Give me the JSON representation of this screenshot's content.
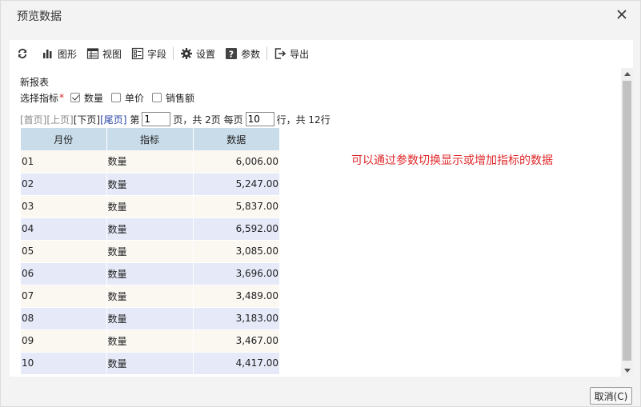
{
  "window": {
    "title": "预览数据"
  },
  "toolbar": {
    "chart": "图形",
    "view": "视图",
    "fields": "字段",
    "settings": "设置",
    "params": "参数",
    "export": "导出"
  },
  "report": {
    "title": "新报表"
  },
  "indicator": {
    "label": "选择指标",
    "required_mark": "*",
    "options": [
      {
        "label": "数量",
        "checked": true
      },
      {
        "label": "单价",
        "checked": false
      },
      {
        "label": "销售额",
        "checked": false
      }
    ]
  },
  "pager": {
    "first": "[首页]",
    "prev": "[上页]",
    "next": "[下页]",
    "last": "[尾页]",
    "page_prefix": "第",
    "page_value": "1",
    "page_suffix": "页，共 2页 每页",
    "size_value": "10",
    "size_suffix": "行，共 12行"
  },
  "table": {
    "headers": [
      "月份",
      "指标",
      "数据"
    ],
    "rows": [
      [
        "01",
        "数量",
        "6,006.00"
      ],
      [
        "02",
        "数量",
        "5,247.00"
      ],
      [
        "03",
        "数量",
        "5,837.00"
      ],
      [
        "04",
        "数量",
        "6,592.00"
      ],
      [
        "05",
        "数量",
        "3,085.00"
      ],
      [
        "06",
        "数量",
        "3,696.00"
      ],
      [
        "07",
        "数量",
        "3,489.00"
      ],
      [
        "08",
        "数量",
        "3,183.00"
      ],
      [
        "09",
        "数量",
        "3,467.00"
      ],
      [
        "10",
        "数量",
        "4,417.00"
      ]
    ]
  },
  "annotation": "可以通过参数切换显示或增加指标的数据",
  "footer": {
    "cancel": "取消(C)"
  },
  "colors": {
    "header_bg": "#c9dcea",
    "row_odd": "#fbf8f2",
    "row_even": "#e5e9f8",
    "annotation": "#e0282a",
    "link_blue": "#2a44a8"
  },
  "icons": [
    "refresh-icon",
    "bar-chart-icon",
    "view-icon",
    "fields-icon",
    "gear-icon",
    "question-icon",
    "export-icon",
    "close-icon"
  ]
}
